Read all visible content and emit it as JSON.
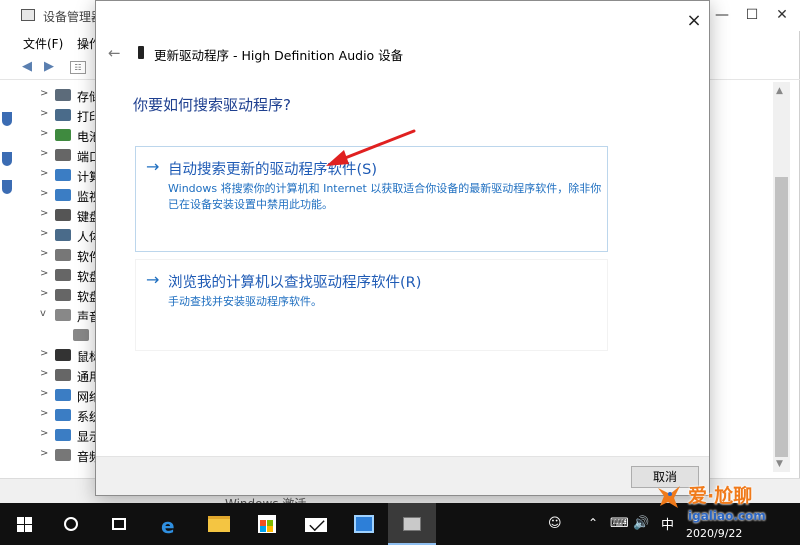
{
  "device_manager": {
    "title": "设备管理器",
    "menu": {
      "file": "文件(F)",
      "action": "操作"
    },
    "tree_items": [
      {
        "label": "存储",
        "arrow": ">"
      },
      {
        "label": "打印",
        "arrow": ">"
      },
      {
        "label": "电池",
        "arrow": ">"
      },
      {
        "label": "端口",
        "arrow": ">"
      },
      {
        "label": "计算",
        "arrow": ">"
      },
      {
        "label": "监视",
        "arrow": ">"
      },
      {
        "label": "键盘",
        "arrow": ">"
      },
      {
        "label": "人体",
        "arrow": ">"
      },
      {
        "label": "软件",
        "arrow": ">"
      },
      {
        "label": "软盘",
        "arrow": ">"
      },
      {
        "label": "软盘",
        "arrow": ">"
      },
      {
        "label": "声音",
        "arrow": "v"
      },
      {
        "label": "",
        "arrow": ""
      },
      {
        "label": "鼠标",
        "arrow": ">"
      },
      {
        "label": "通用",
        "arrow": ">"
      },
      {
        "label": "网络",
        "arrow": ">"
      },
      {
        "label": "系统",
        "arrow": ">"
      },
      {
        "label": "显示",
        "arrow": ">"
      },
      {
        "label": "音频",
        "arrow": ">"
      }
    ],
    "status_watermark": "Windows 激活"
  },
  "dialog": {
    "title": "更新驱动程序 - High Definition Audio 设备",
    "heading": "你要如何搜索驱动程序?",
    "options": [
      {
        "title": "自动搜索更新的驱动程序软件(S)",
        "description": "Windows 将搜索你的计算机和 Internet 以获取适合你设备的最新驱动程序软件，除非你已在设备安装设置中禁用此功能。"
      },
      {
        "title": "浏览我的计算机以查找驱动程序软件(R)",
        "description": "手动查找并安装驱动程序软件。"
      }
    ],
    "cancel_label": "取消",
    "close_glyph": "×",
    "back_glyph": "←",
    "arrow_glyph": "→"
  },
  "taskbar": {
    "clock_time": "",
    "clock_date": "2020/9/22",
    "ime_label": "中"
  },
  "watermark": {
    "name": "爱·尬聊",
    "url": "igaliao.com"
  },
  "colors": {
    "accent_link": "#1f5bb5",
    "heading": "#1e3f8f",
    "annotation_arrow": "#e02020",
    "taskbar": "#101010",
    "brand_orange": "#f07a1a",
    "brand_blue": "#2b66c4"
  },
  "icons": [
    "device-manager-icon",
    "back-arrow-icon",
    "forward-arrow-icon",
    "properties-icon",
    "speaker-device-icon",
    "windows-logo-icon",
    "search-circle-icon",
    "task-view-icon",
    "edge-icon",
    "file-explorer-icon",
    "store-icon",
    "mail-icon",
    "people-icon",
    "volume-icon",
    "network-icon"
  ]
}
